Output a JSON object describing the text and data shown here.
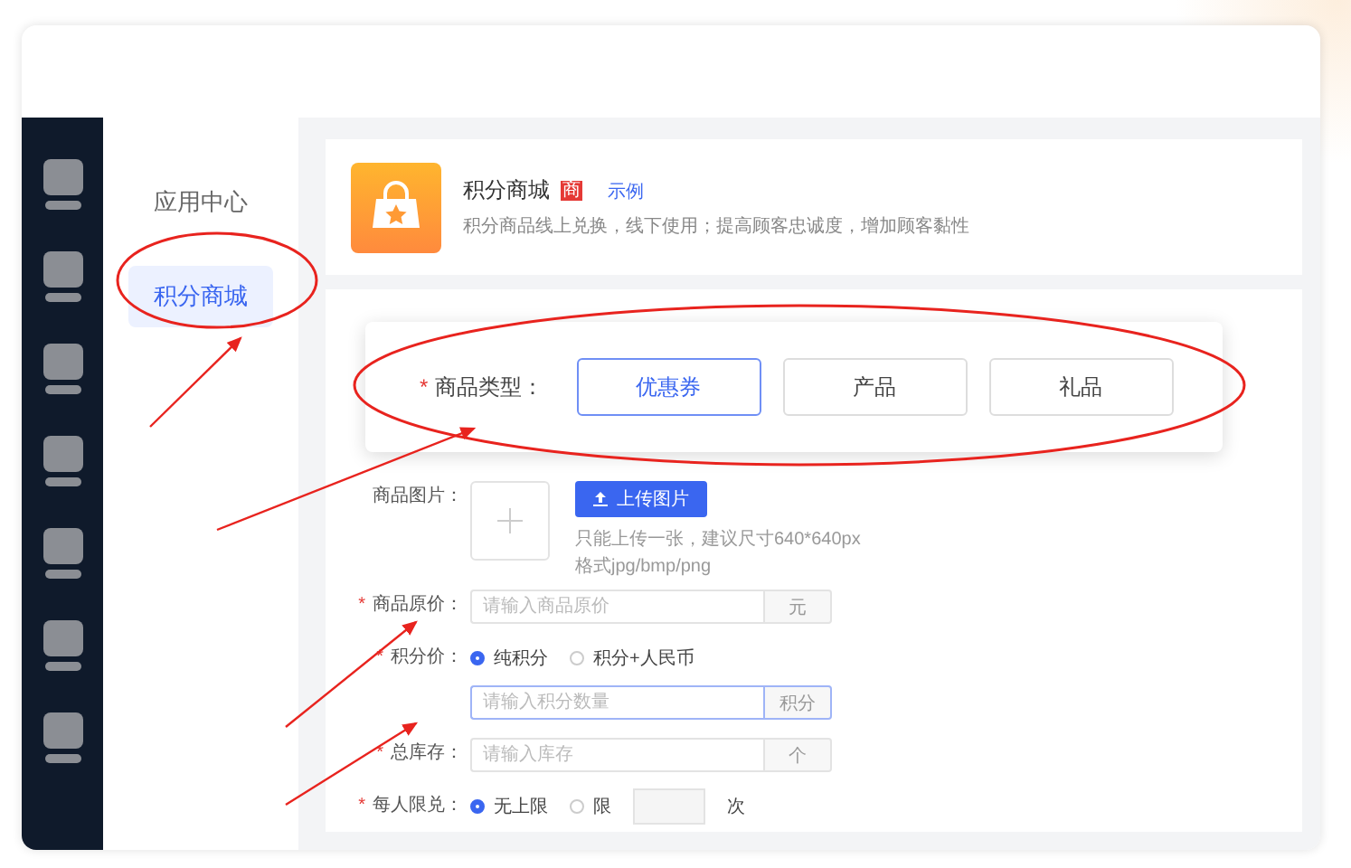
{
  "nav": {
    "items": [
      {
        "label": "应用中心",
        "selected": false
      },
      {
        "label": "积分商城",
        "selected": true
      }
    ]
  },
  "app": {
    "title": "积分商城",
    "badge": "商",
    "link": "示例",
    "description": "积分商品线上兑换，线下使用；提高顾客忠诚度，增加顾客黏性"
  },
  "type_selector": {
    "label": "商品类型：",
    "required_mark": "*",
    "options": [
      {
        "label": "优惠券",
        "selected": true
      },
      {
        "label": "产品",
        "selected": false
      },
      {
        "label": "礼品",
        "selected": false
      }
    ]
  },
  "fields": [
    {
      "kind": "upload",
      "label": "商品图片：",
      "button": "上传图片",
      "hints": [
        "只能上传一张，建议尺寸640*640px",
        "格式jpg/bmp/png"
      ]
    },
    {
      "kind": "input",
      "label": "商品原价：",
      "required_mark": "*",
      "placeholder": "请输入商品原价",
      "addon": "元",
      "focused": false
    },
    {
      "kind": "radio-input",
      "label": "积分价：",
      "required_mark": "*",
      "options": [
        {
          "label": "纯积分",
          "selected": true
        },
        {
          "label": "积分+人民币",
          "selected": false
        }
      ],
      "placeholder": "请输入积分数量",
      "addon": "积分",
      "focused": true
    },
    {
      "kind": "input",
      "label": "总库存：",
      "required_mark": "*",
      "placeholder": "请输入库存",
      "addon": "个",
      "focused": false
    },
    {
      "kind": "radio-limit",
      "label": "每人限兑：",
      "required_mark": "*",
      "options": [
        {
          "label": "无上限",
          "selected": true
        },
        {
          "label": "限",
          "selected": false
        }
      ],
      "suffix": "次"
    }
  ]
}
